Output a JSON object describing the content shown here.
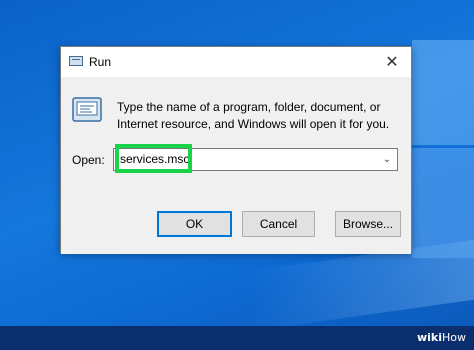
{
  "dialog": {
    "title": "Run",
    "description": "Type the name of a program, folder, document, or Internet resource, and Windows will open it for you.",
    "open_label": "Open:",
    "open_value": "services.msc",
    "buttons": {
      "ok": "OK",
      "cancel": "Cancel",
      "browse": "Browse..."
    }
  },
  "icons": {
    "title": "run-icon",
    "close": "close-icon",
    "dropdown": "chevron-down-icon"
  },
  "watermark": {
    "wiki": "wiki",
    "how": "How"
  },
  "colors": {
    "highlight": "#19d44a",
    "desktop": "#1577dc",
    "default_button_border": "#0078d7"
  }
}
